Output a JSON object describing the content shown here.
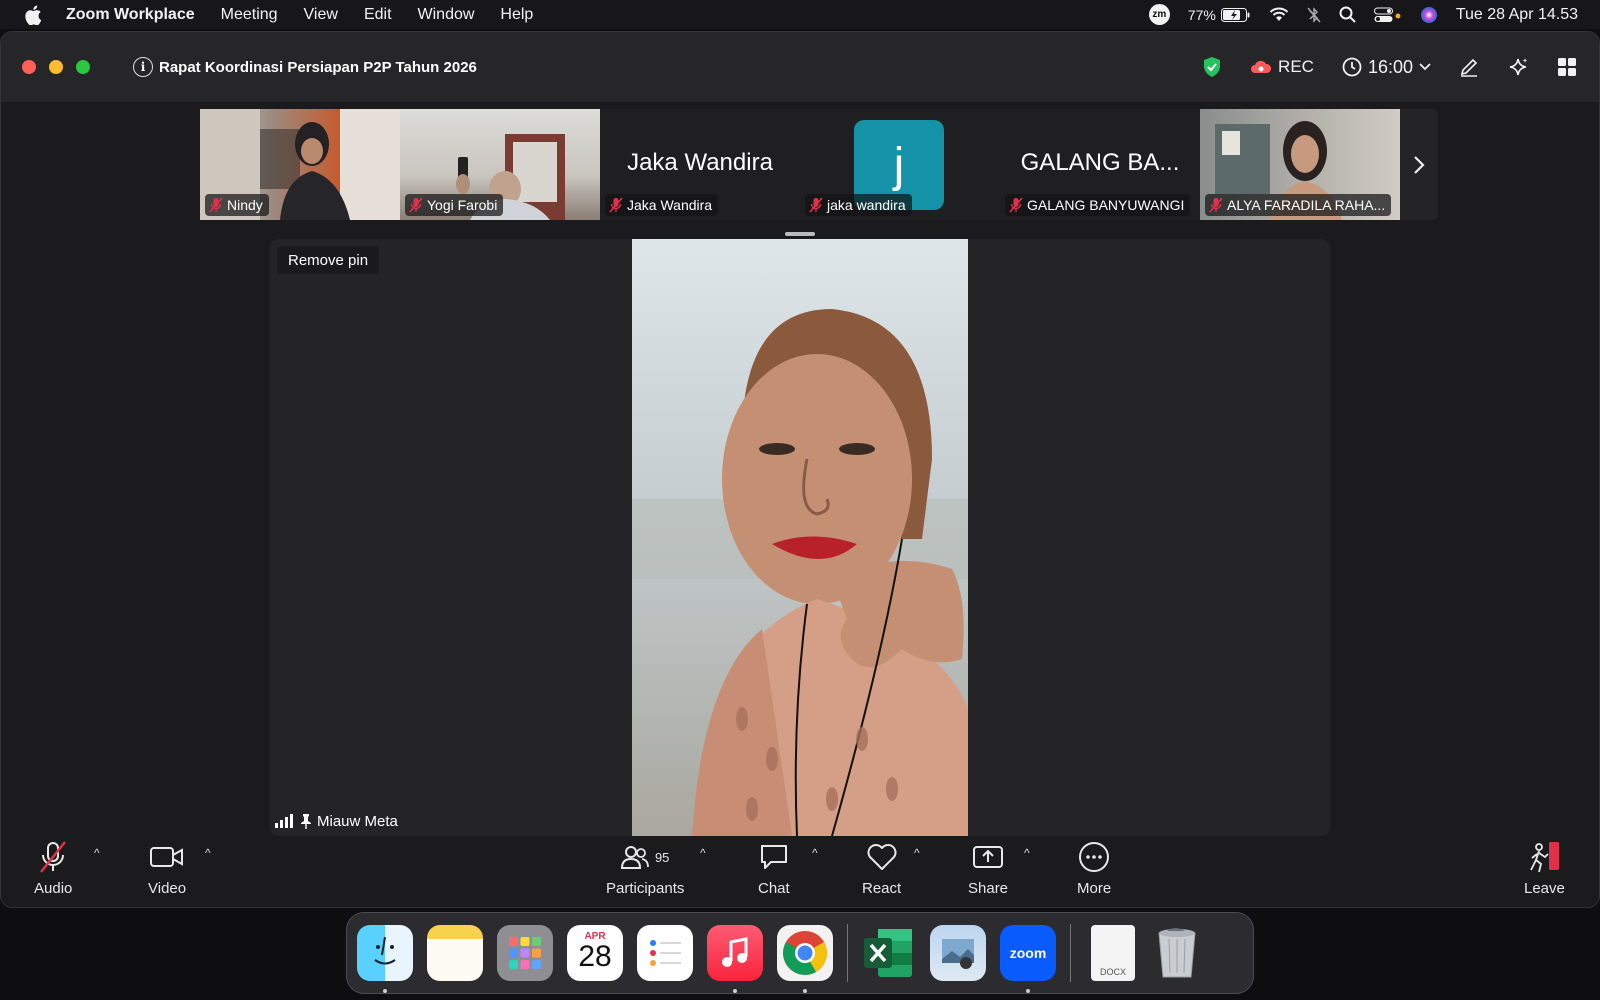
{
  "menubar": {
    "app_name": "Zoom Workplace",
    "menus": [
      "Meeting",
      "View",
      "Edit",
      "Window",
      "Help"
    ],
    "zoom_status_icon": "zm",
    "battery": "77%",
    "clock": "Tue 28 Apr  14.53"
  },
  "window": {
    "meeting_title": "Rapat Koordinasi Persiapan P2P Tahun 2026",
    "rec_label": "REC",
    "timer": "16:00"
  },
  "thumbnails": [
    {
      "name": "Nindy",
      "type": "video",
      "muted": true
    },
    {
      "name": "Yogi Farobi",
      "type": "video",
      "muted": true
    },
    {
      "name": "Jaka Wandira",
      "display_name": "Jaka Wandira",
      "type": "name",
      "muted": true
    },
    {
      "name": "jaka wandira",
      "avatar_letter": "j",
      "type": "avatar",
      "muted": true,
      "avatar_color": "#1493a8"
    },
    {
      "name": "GALANG BANYUWANGI",
      "display_name": "GALANG BA...",
      "type": "name",
      "muted": true
    },
    {
      "name": "ALYA FARADILA RAHA...",
      "type": "video",
      "muted": true
    }
  ],
  "main_stage": {
    "remove_pin_label": "Remove pin",
    "speaker_name": "Miauw Meta"
  },
  "toolbar": {
    "audio_label": "Audio",
    "video_label": "Video",
    "participants_label": "Participants",
    "participants_count": "95",
    "chat_label": "Chat",
    "react_label": "React",
    "share_label": "Share",
    "more_label": "More",
    "leave_label": "Leave",
    "caret": "^"
  },
  "dock": {
    "calendar_month": "APR",
    "calendar_day": "28",
    "zoom_label": "zoom",
    "docx_label": "DOCX"
  },
  "colors": {
    "mute_red": "#e0314b",
    "shield_green": "#25c360",
    "rec_red": "#ff5a5a",
    "zoom_blue": "#0b5cff"
  }
}
